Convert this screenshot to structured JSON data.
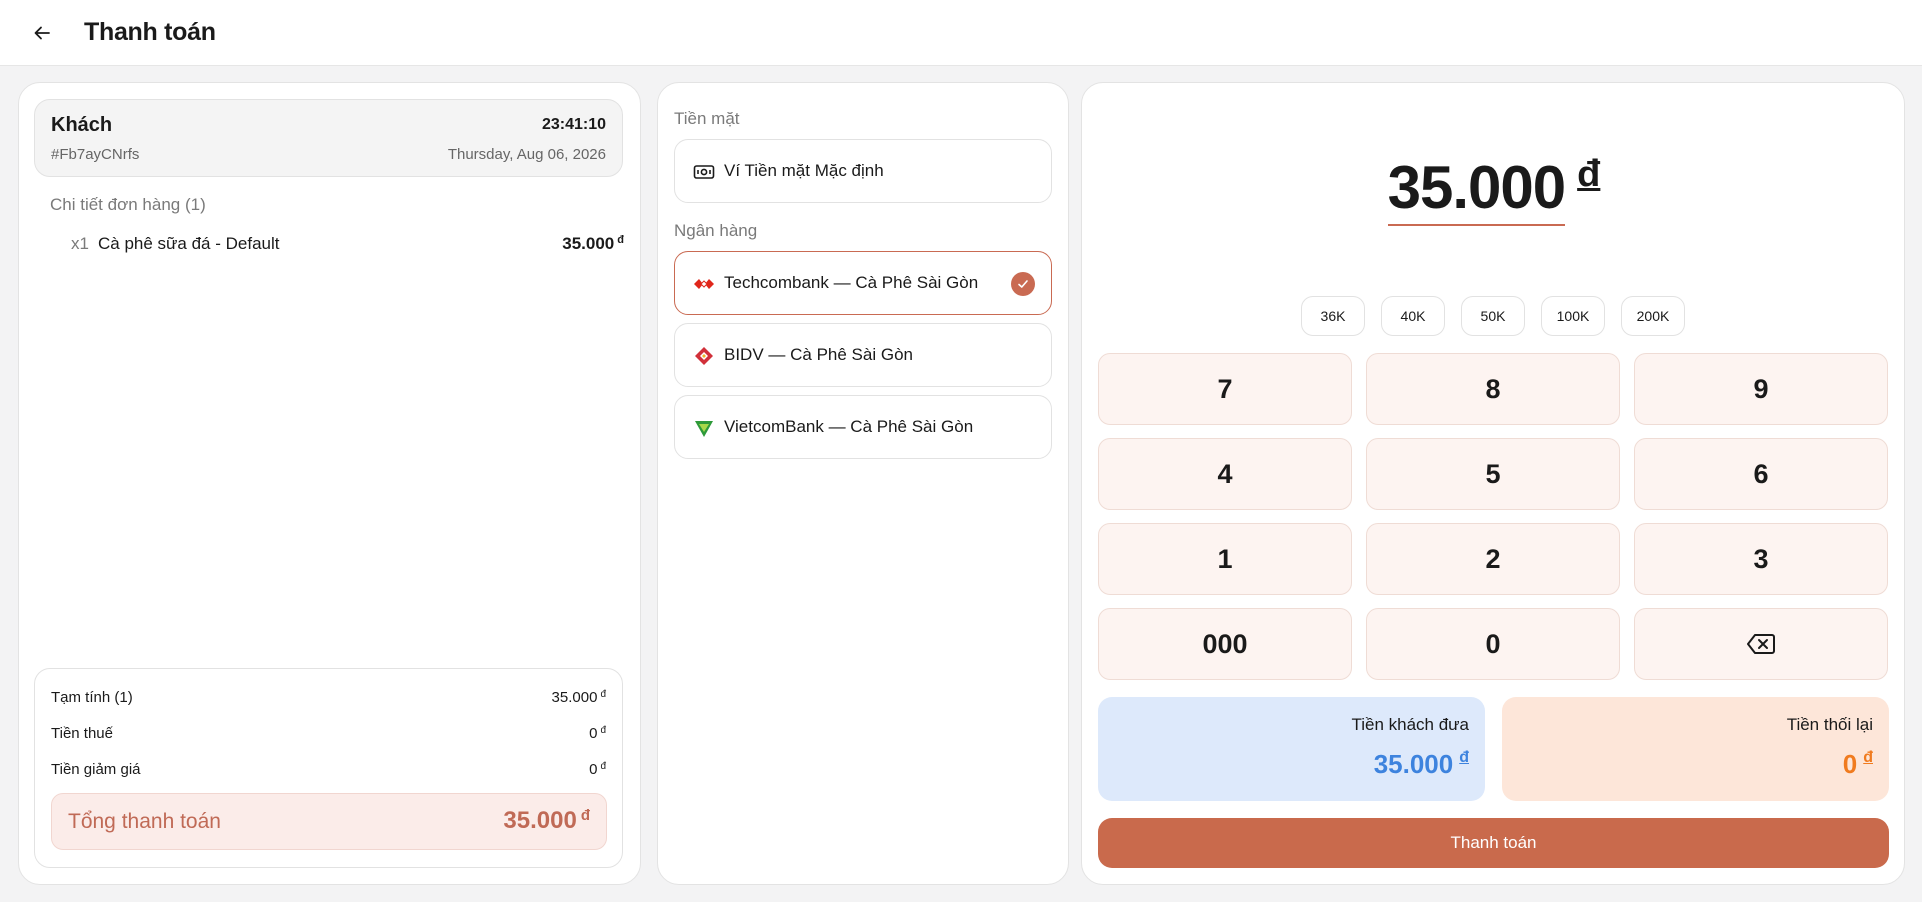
{
  "header": {
    "title": "Thanh toán",
    "back_icon": "arrow-left-icon"
  },
  "customer": {
    "name": "Khách",
    "id": "#Fb7ayCNrfs",
    "time": "23:41:10",
    "date": "Thursday, Aug 06, 2026"
  },
  "order": {
    "heading": "Chi tiết đơn hàng (1)",
    "items": [
      {
        "qty": "x1",
        "name": "Cà phê sữa đá - Default",
        "price": "35.000",
        "currency": "đ"
      }
    ]
  },
  "summary": {
    "rows": [
      {
        "label": "Tạm tính (1)",
        "value": "35.000",
        "currency": "đ"
      },
      {
        "label": "Tiền thuế",
        "value": "0",
        "currency": "đ"
      },
      {
        "label": "Tiền giảm giá",
        "value": "0",
        "currency": "đ"
      }
    ],
    "total_label": "Tổng thanh toán",
    "total_value": "35.000",
    "total_currency": "đ"
  },
  "payment_methods": {
    "cash_label": "Tiền mặt",
    "cash": [
      {
        "label": "Ví Tiền mặt Mặc định",
        "icon": "cash-icon",
        "selected": false
      }
    ],
    "bank_label": "Ngân hàng",
    "banks": [
      {
        "label": "Techcombank — Cà Phê Sài Gòn",
        "icon": "techcombank-logo-icon",
        "selected": true,
        "color": "#e0261b"
      },
      {
        "label": "BIDV — Cà Phê Sài Gòn",
        "icon": "bidv-logo-icon",
        "selected": false,
        "color": "#d1303a"
      },
      {
        "label": "VietcomBank — Cà Phê Sài Gòn",
        "icon": "vietcombank-logo-icon",
        "selected": false,
        "color": "#2e9a3a"
      }
    ]
  },
  "keypad": {
    "amount": "35.000",
    "currency": "đ",
    "quick_amounts": [
      "36K",
      "40K",
      "50K",
      "100K",
      "200K"
    ],
    "keys": [
      "7",
      "8",
      "9",
      "4",
      "5",
      "6",
      "1",
      "2",
      "3",
      "000",
      "0"
    ],
    "backspace_icon": "backspace-icon",
    "given_label": "Tiền khách đưa",
    "given_value": "35.000",
    "change_label": "Tiền thối lại",
    "change_value": "0",
    "pay_label": "Thanh toán"
  },
  "colors": {
    "accent": "#c96a4c",
    "given_bg": "#dde9fb",
    "given_text": "#3d83de",
    "change_bg": "#fde6d9",
    "change_text": "#f07b1f"
  }
}
